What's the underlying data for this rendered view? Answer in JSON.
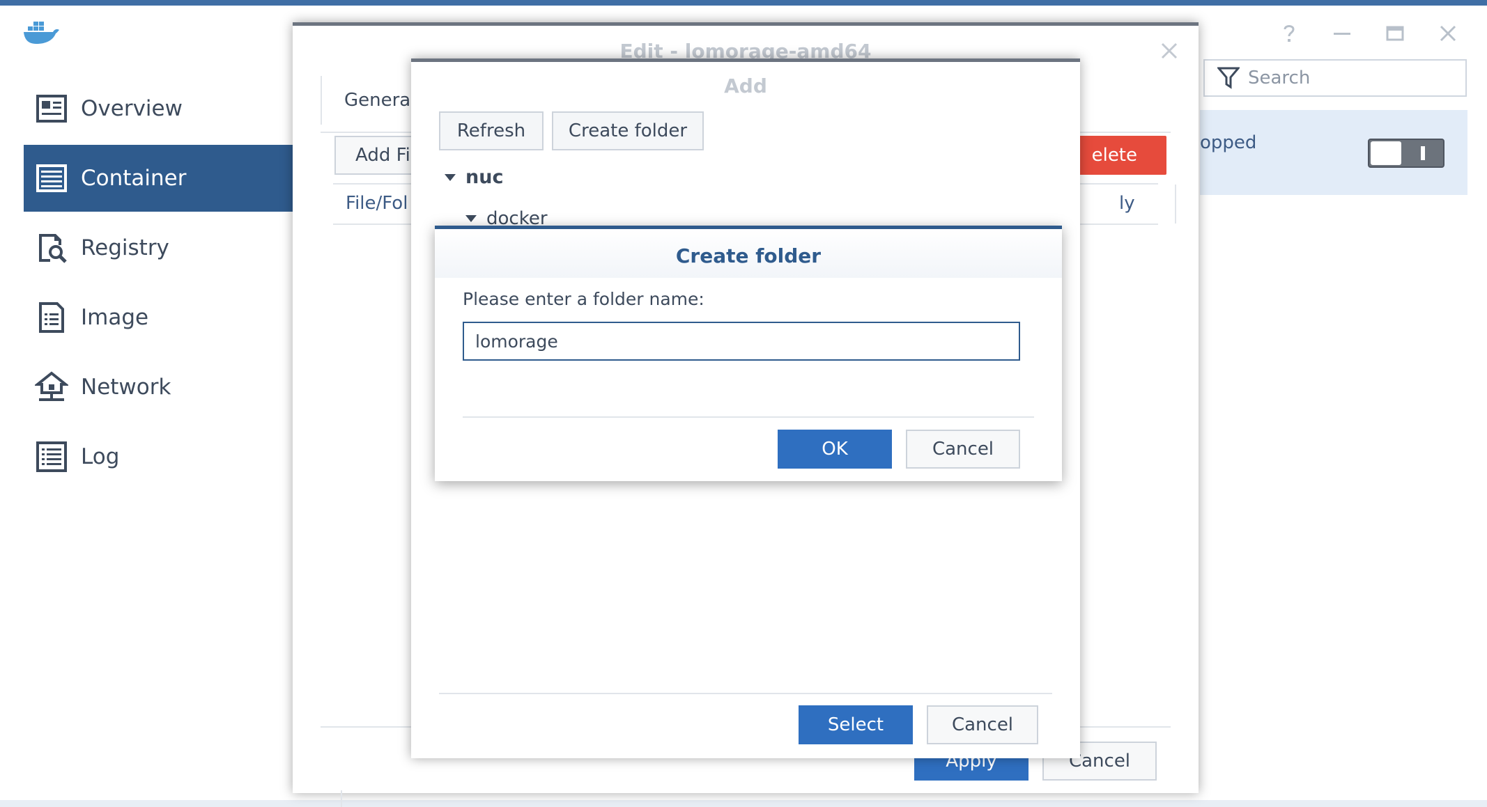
{
  "sidebar": {
    "items": [
      {
        "label": "Overview",
        "icon": "overview-icon"
      },
      {
        "label": "Container",
        "icon": "container-icon",
        "active": true
      },
      {
        "label": "Registry",
        "icon": "registry-icon"
      },
      {
        "label": "Image",
        "icon": "image-icon"
      },
      {
        "label": "Network",
        "icon": "network-icon"
      },
      {
        "label": "Log",
        "icon": "log-icon"
      }
    ]
  },
  "search": {
    "placeholder": "Search"
  },
  "container_row": {
    "status": "opped"
  },
  "edit_dialog": {
    "title": "Edit - lomorage-amd64",
    "tab": "General",
    "add_file_label": "Add Fil",
    "delete_label": "elete",
    "col_file": "File/Fol",
    "col_readonly": "ly",
    "apply_label": "Apply",
    "cancel_label": "Cancel"
  },
  "add_dialog": {
    "title": "Add",
    "refresh_label": "Refresh",
    "create_folder_label": "Create folder",
    "tree": {
      "root": "nuc",
      "child": "docker"
    },
    "select_label": "Select",
    "cancel_label": "Cancel"
  },
  "create_folder_dialog": {
    "title": "Create folder",
    "prompt": "Please enter a folder name:",
    "input_value": "lomorage",
    "ok_label": "OK",
    "cancel_label": "Cancel"
  },
  "colors": {
    "accent": "#2f5b8d",
    "primary_button": "#2f6fc0",
    "danger": "#e64b3c"
  }
}
